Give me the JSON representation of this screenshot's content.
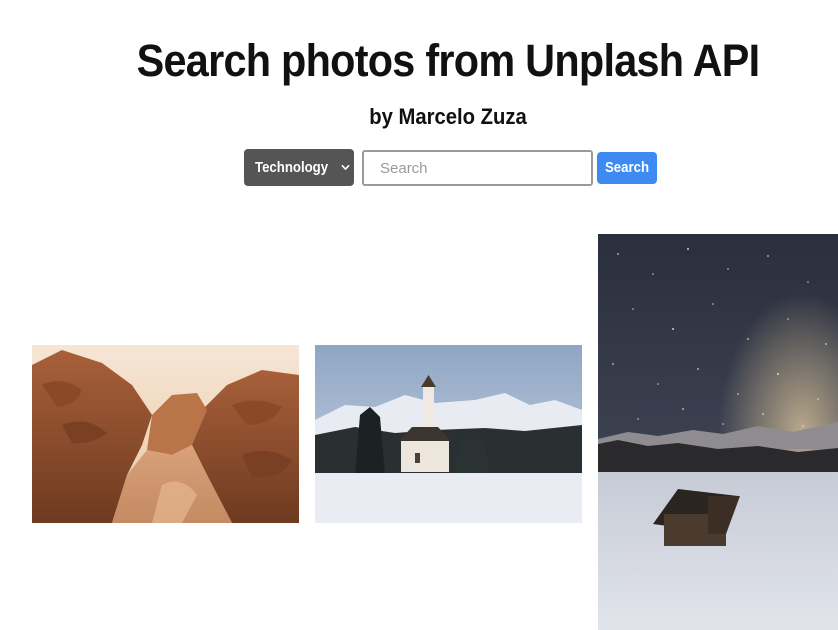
{
  "header": {
    "title": "Search photos from Unplash API",
    "subtitle": "by Marcelo Zuza"
  },
  "search": {
    "category_selected": "Technology",
    "input_value": "",
    "input_placeholder": "Search",
    "button_label": "Search"
  },
  "colors": {
    "select_bg": "#555555",
    "button_bg": "#3d8bf2",
    "text": "#111111"
  },
  "icons": {
    "select_arrow": "chevron-down-icon"
  },
  "photos": [
    {
      "name": "desert-canyon-photo"
    },
    {
      "name": "mountain-church-photo"
    },
    {
      "name": "starry-night-cabin-photo"
    }
  ]
}
